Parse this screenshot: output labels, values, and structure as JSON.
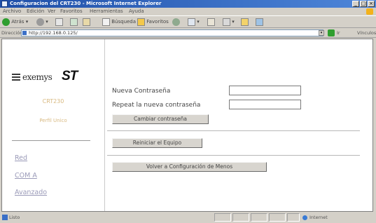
{
  "window": {
    "title": "Configuracion del CRT230 - Microsoft Internet Explorer",
    "minimize": "_",
    "maximize": "□",
    "close": "×"
  },
  "menu": [
    "Archivo",
    "Edición",
    "Ver",
    "Favoritos",
    "Herramientas",
    "Ayuda"
  ],
  "toolbar": {
    "back": "Atrás",
    "search": "Búsqueda",
    "favorites": "Favoritos"
  },
  "address": {
    "label": "Dirección",
    "url": "http://192.168.0.125/",
    "go": "Ir",
    "links": "Vínculos"
  },
  "sidebar": {
    "brand": "exemys",
    "brand_mark": "ST",
    "model": "CRT230",
    "profile": "Perfil Unico",
    "links": [
      "Red",
      "COM A",
      "Avanzado"
    ]
  },
  "main": {
    "new_password_label": "Nueva Contraseña",
    "repeat_password_label": "Repeat la nueva contraseña",
    "change_password_button": "Cambiar contraseña",
    "restart_button": "Reiniciar el Equipo",
    "back_button": "Volver a Configuración de Menos"
  },
  "status": {
    "text": "Listo",
    "zone": "Internet"
  },
  "colors": {
    "title_bar": "#1f4fa8",
    "chrome": "#d4d0c8",
    "muted_label": "#d8b980",
    "link": "#9a9ab8"
  }
}
